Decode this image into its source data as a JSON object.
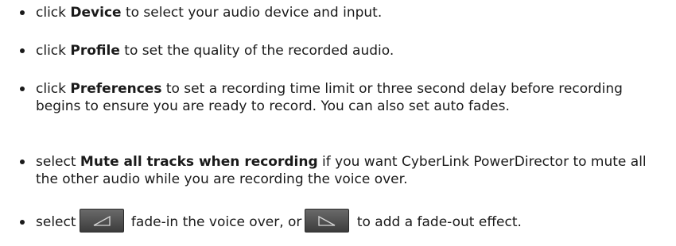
{
  "items": [
    {
      "pre": "click ",
      "bold": "Device",
      "post": " to select your audio device and input."
    },
    {
      "pre": "click ",
      "bold": "Profile",
      "post": " to set the quality of the recorded audio."
    },
    {
      "pre": "click ",
      "bold": "Preferences",
      "post": " to set a recording time limit or three second delay before recording begins to ensure you are ready to record. You can also set auto fades."
    },
    {
      "pre": "select ",
      "bold": "Mute all tracks when recording",
      "post": " if you want CyberLink PowerDirector to mute all the other audio while you are recording the voice over."
    },
    {
      "pre": "select",
      "mid": " fade-in the voice over, or",
      "post": " to add a fade-out effect."
    }
  ],
  "icons": {
    "fade_in": "fade-in-icon",
    "fade_out": "fade-out-icon",
    "button_color": "#4f4f4f"
  }
}
